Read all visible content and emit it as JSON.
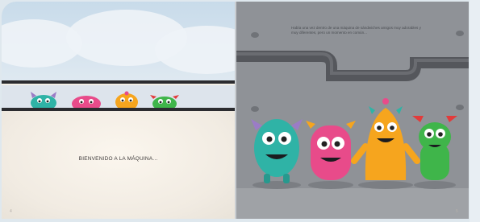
{
  "left_page": {
    "caption": "BIENVENIDO A LA MÁQUINA...",
    "page_number": "4"
  },
  "right_page": {
    "body_text": "Había una vez dentro de una máquina de sándwiches amigos muy adorables y muy diferentes, pero un momento en común...",
    "page_number": "5"
  },
  "characters": [
    "teal-monster",
    "pink-monster",
    "orange-monster",
    "green-monster"
  ],
  "colors": {
    "teal": "#2fb3a6",
    "pink": "#e84b8a",
    "orange": "#f6a51e",
    "green": "#3fb54a",
    "purple_ears": "#9b7cc6",
    "machine_grey": "#8f9297",
    "pipe": "#55575c"
  }
}
